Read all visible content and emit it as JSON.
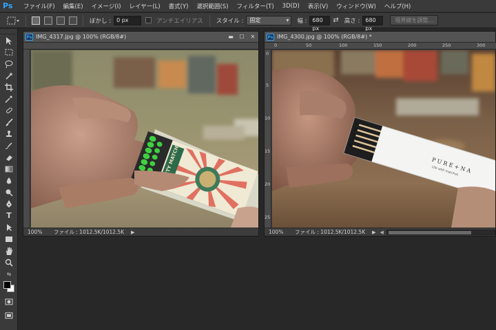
{
  "app": {
    "logo": "Ps"
  },
  "menu": [
    {
      "id": "file",
      "label": "ファイル(F)"
    },
    {
      "id": "edit",
      "label": "編集(E)"
    },
    {
      "id": "image",
      "label": "イメージ(I)"
    },
    {
      "id": "layer",
      "label": "レイヤー(L)"
    },
    {
      "id": "type",
      "label": "書式(Y)"
    },
    {
      "id": "select",
      "label": "選択範囲(S)"
    },
    {
      "id": "filter",
      "label": "フィルター(T)"
    },
    {
      "id": "3d",
      "label": "3D(D)"
    },
    {
      "id": "view",
      "label": "表示(V)"
    },
    {
      "id": "window",
      "label": "ウィンドウ(W)"
    },
    {
      "id": "help",
      "label": "ヘルプ(H)"
    }
  ],
  "options": {
    "feather_label": "ぼかし :",
    "feather_value": "0 px",
    "antialias_label": "アンチエイリアス",
    "style_label": "スタイル :",
    "style_value": "固定",
    "width_label": "幅 :",
    "width_value": "680 px",
    "height_label": "高さ :",
    "height_value": "680 px",
    "refine_edge": "境界線を調整..."
  },
  "doc1": {
    "title": "IMG_4317.jpg @ 100% (RGB/8#)",
    "zoom": "100%",
    "filesize": "ファイル : 1012.5K/1012.5K"
  },
  "doc2": {
    "title": "IMG_4300.jpg @ 100% (RGB/8#) *",
    "zoom": "100%",
    "filesize": "ファイル : 1012.5K/1012.5K",
    "ruler_top": [
      "0",
      "50",
      "100",
      "150",
      "200",
      "250",
      "300"
    ],
    "ruler_left": [
      "0",
      "5",
      "10",
      "15",
      "20",
      "25"
    ]
  },
  "photo1": {
    "matchbox_label": "SAFETY MATCH"
  },
  "photo2": {
    "brand": "P U R E + N A",
    "tagline": "Life with matches"
  },
  "colors": {
    "accent": "#31a8ff",
    "ui_dark": "#282828",
    "ui_panel": "#3a3a3a"
  }
}
